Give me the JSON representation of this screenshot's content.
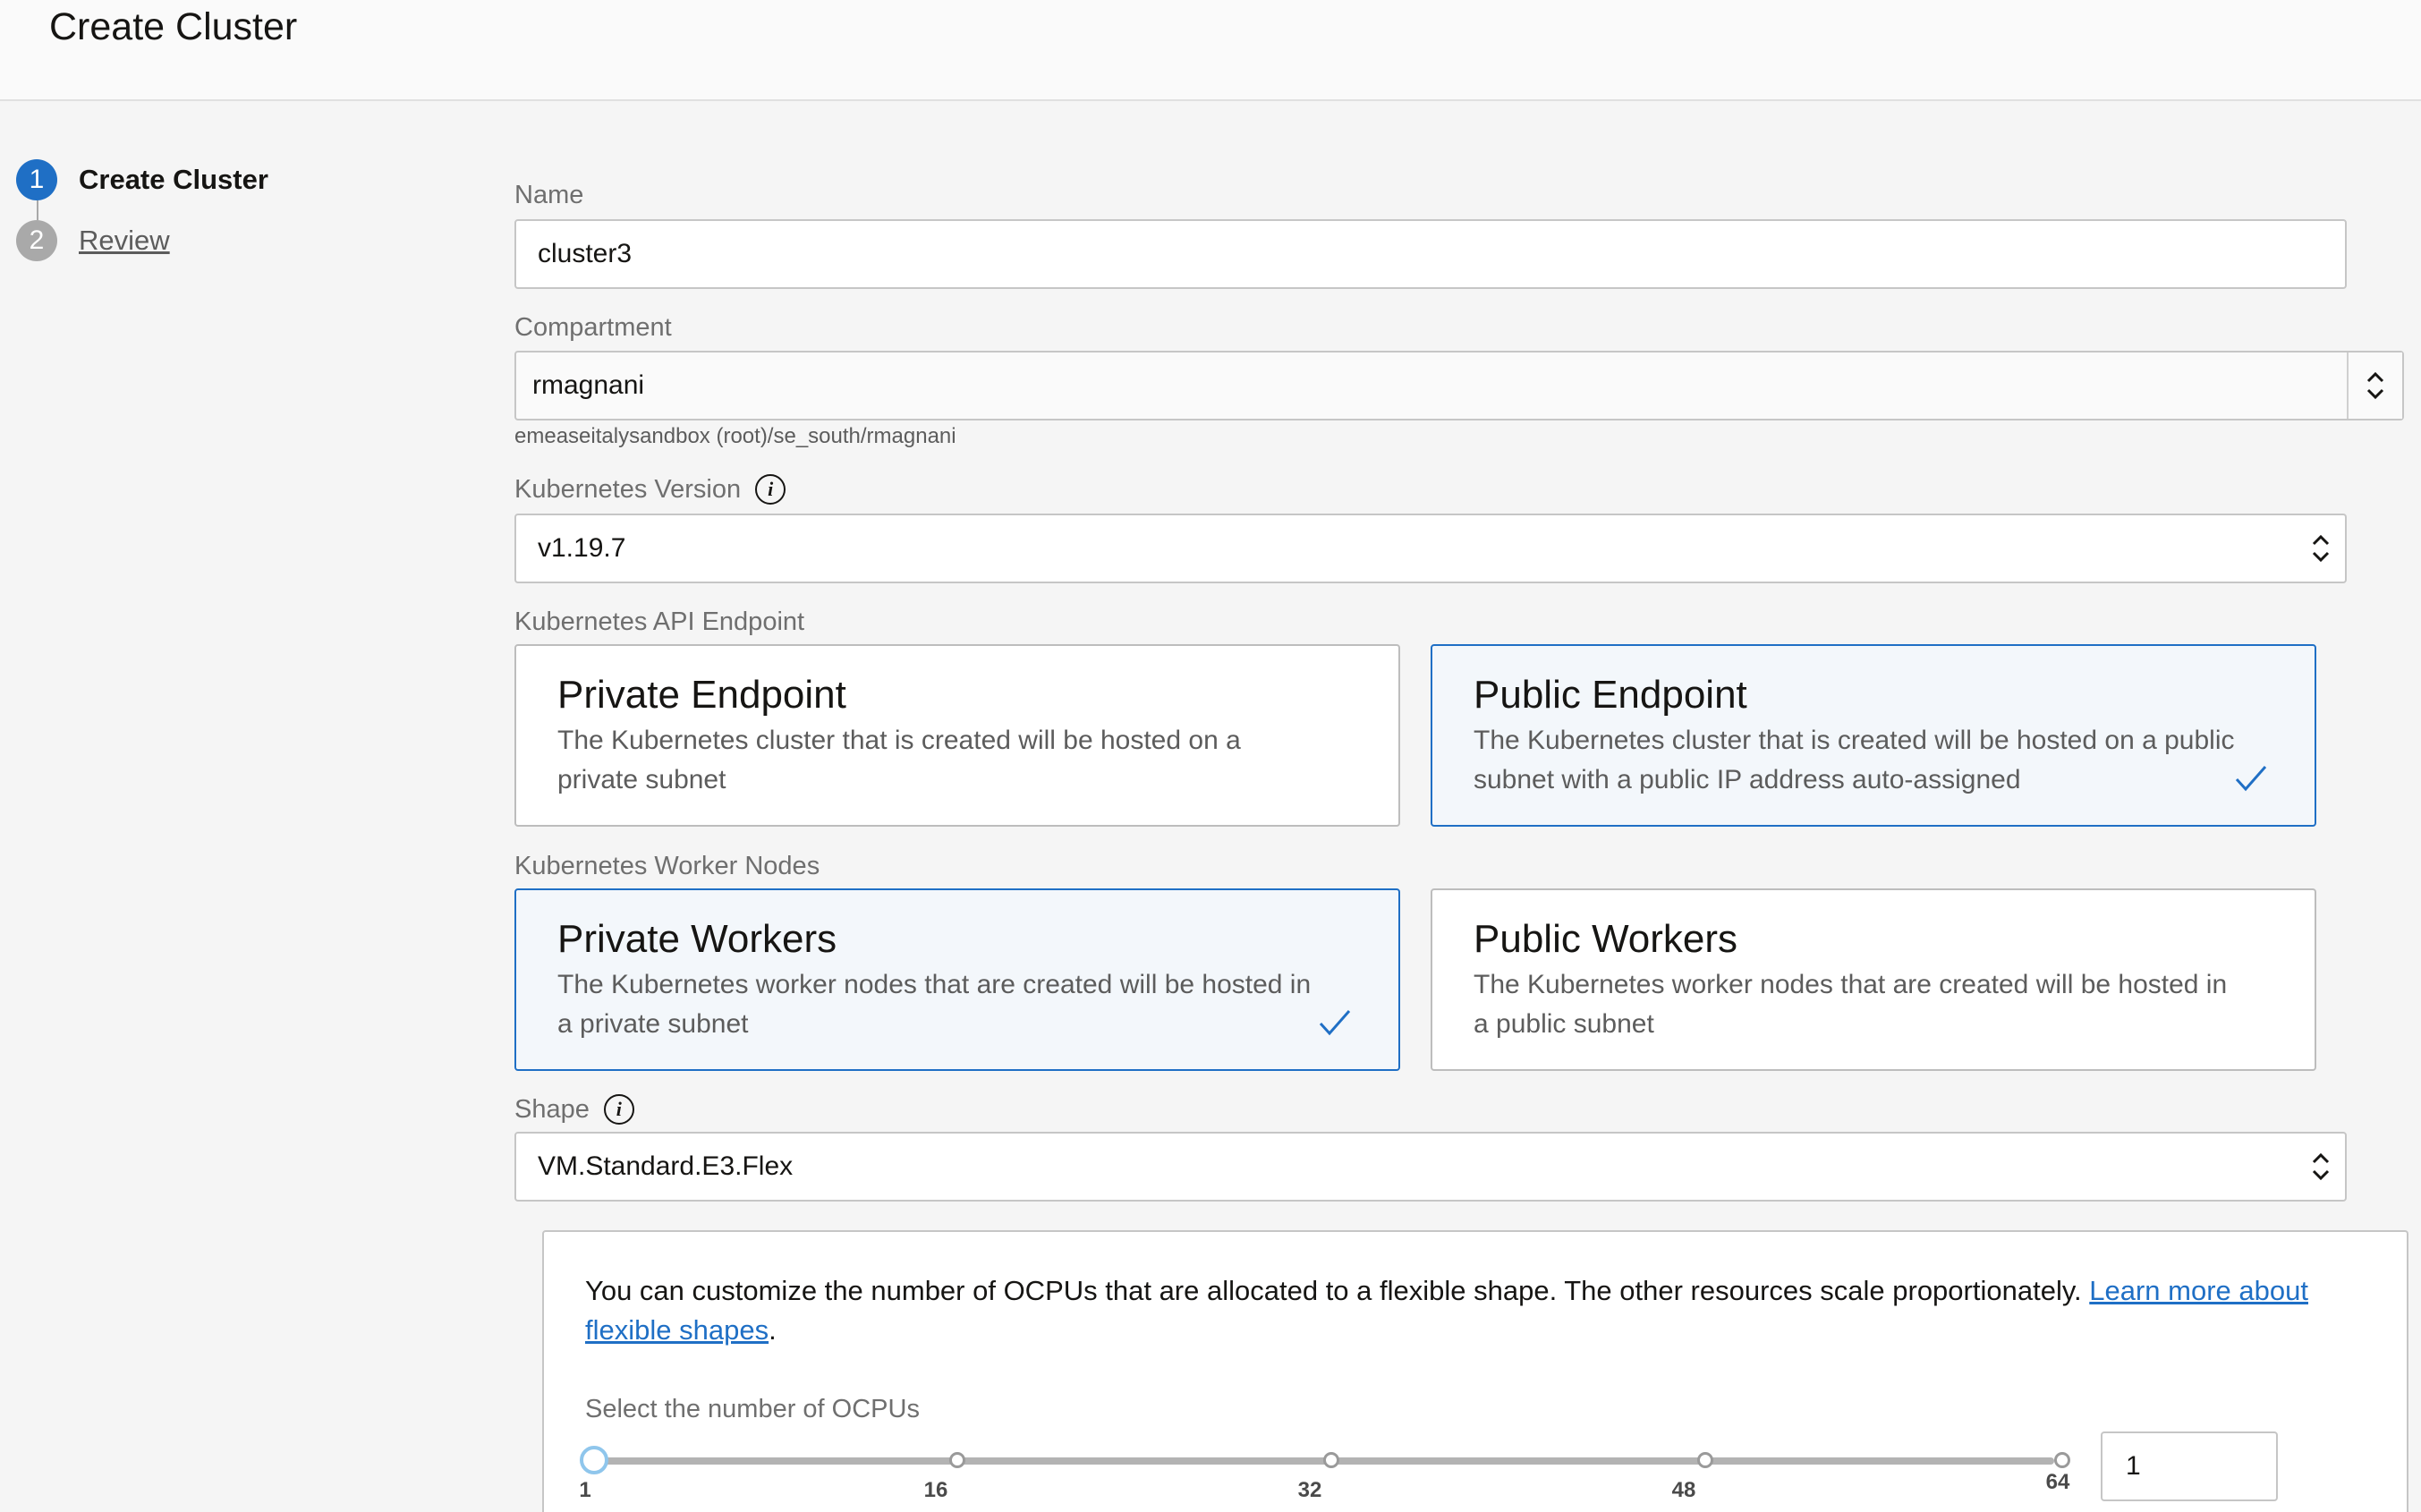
{
  "header": {
    "title": "Create Cluster"
  },
  "steps": [
    {
      "number": "1",
      "label": "Create Cluster",
      "active": true
    },
    {
      "number": "2",
      "label": "Review",
      "active": false
    }
  ],
  "form": {
    "name": {
      "label": "Name",
      "value": "cluster3"
    },
    "compartment": {
      "label": "Compartment",
      "value": "rmagnani",
      "helper": "emeaseitalysandbox (root)/se_south/rmagnani"
    },
    "kubernetes_version": {
      "label": "Kubernetes Version",
      "value": "v1.19.7",
      "icon": "info-icon"
    },
    "api_endpoint": {
      "label": "Kubernetes API Endpoint",
      "options": [
        {
          "title": "Private Endpoint",
          "description": "The Kubernetes cluster that is created will be hosted on a private subnet",
          "selected": false
        },
        {
          "title": "Public Endpoint",
          "description": "The Kubernetes cluster that is created will be hosted on a public subnet with a public IP address auto-assigned",
          "selected": true
        }
      ]
    },
    "worker_nodes": {
      "label": "Kubernetes Worker Nodes",
      "options": [
        {
          "title": "Private Workers",
          "description": "The Kubernetes worker nodes that are created will be hosted in a private subnet",
          "selected": true
        },
        {
          "title": "Public Workers",
          "description": "The Kubernetes worker nodes that are created will be hosted in a public subnet",
          "selected": false
        }
      ]
    },
    "shape": {
      "label": "Shape",
      "value": "VM.Standard.E3.Flex",
      "icon": "info-icon"
    },
    "flex": {
      "text": "You can customize the number of OCPUs that are allocated to a flexible shape. The other resources scale proportionately.",
      "link": "Learn more about flexible shapes",
      "link_suffix": ".",
      "ocpu_label": "Select the number of OCPUs",
      "slider_ticks": [
        "1",
        "16",
        "32",
        "48",
        "64"
      ],
      "slider_min": 1,
      "slider_max": 64,
      "slider_value": 1,
      "ocpu_value": "1"
    }
  },
  "colors": {
    "accent": "#1f6fc5",
    "selected_bg": "#f3f7fb",
    "border": "#c6c6c6"
  }
}
